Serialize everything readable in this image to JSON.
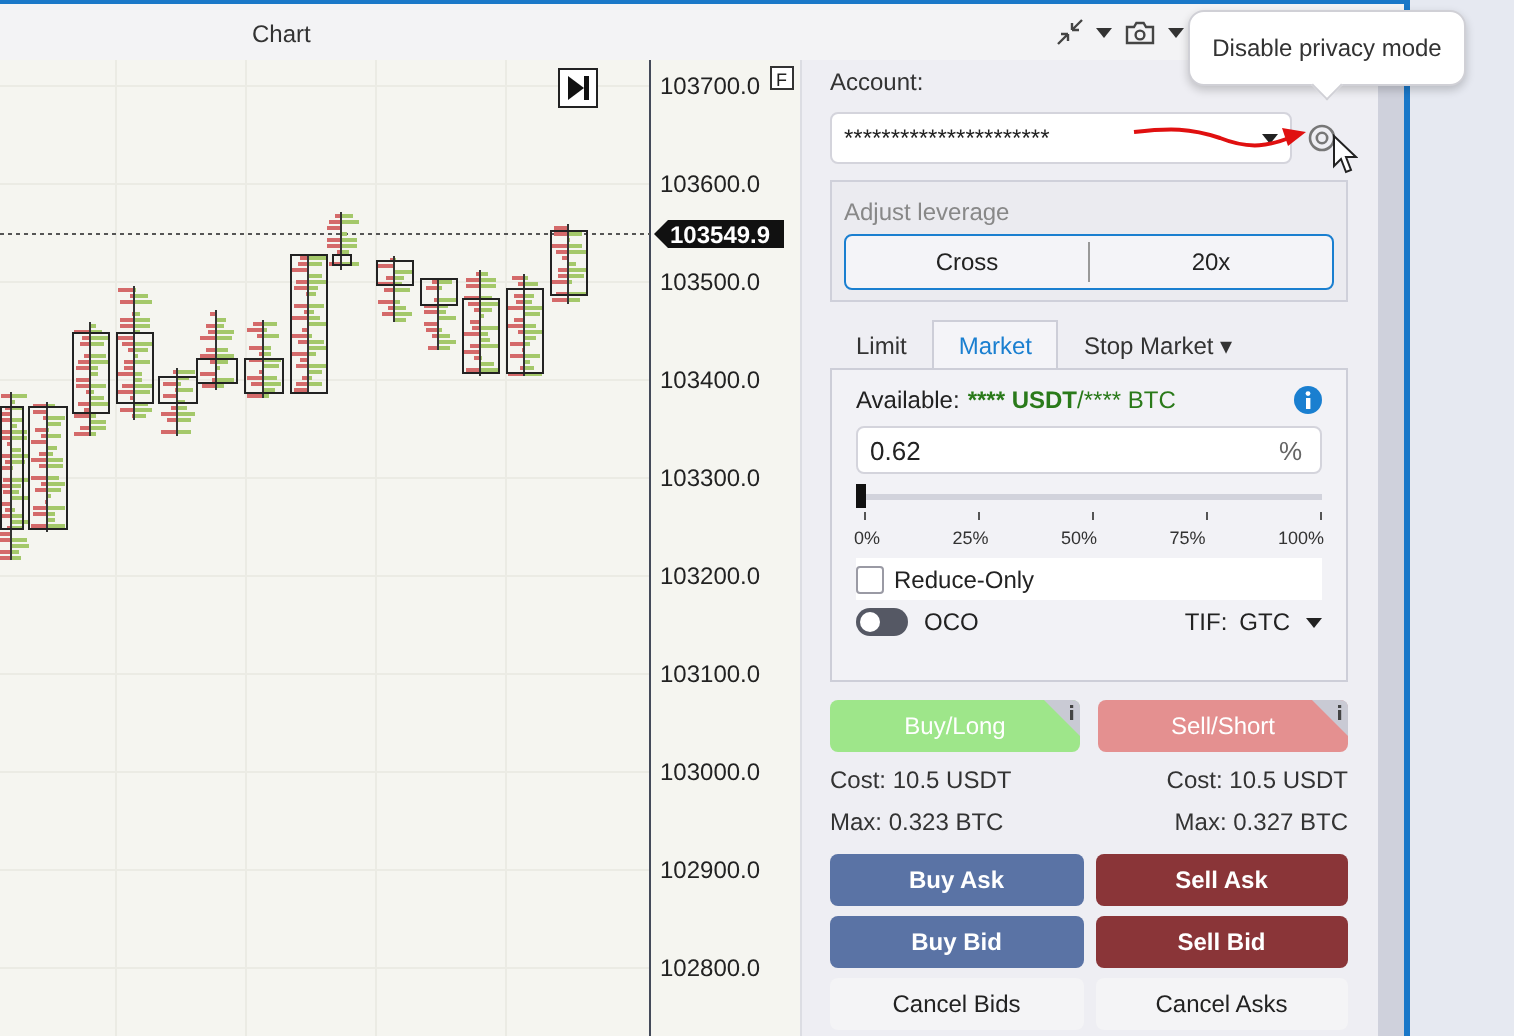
{
  "window": {
    "title": "Chart"
  },
  "chart": {
    "price_labels": [
      "103700.0",
      "103600.0",
      "103500.0",
      "103400.0",
      "103300.0",
      "103200.0",
      "103100.0",
      "103000.0",
      "102900.0",
      "102800.0"
    ],
    "current_price": "103549.9",
    "scale_button": "F"
  },
  "tooltip": {
    "text": "Disable privacy mode"
  },
  "order_panel": {
    "account": {
      "label": "Account:",
      "value": "**********************"
    },
    "leverage": {
      "label": "Adjust leverage",
      "margin_mode": "Cross",
      "value": "20x"
    },
    "tabs": [
      {
        "label": "Limit",
        "selected": false
      },
      {
        "label": "Market",
        "selected": true
      },
      {
        "label": "Stop Market ▾",
        "selected": false
      }
    ],
    "available": {
      "label": "Available:",
      "quote": "**** USDT",
      "base": "/**** BTC"
    },
    "amount": {
      "value": "0.62",
      "unit": "%"
    },
    "slider": {
      "level": 0,
      "ticks": [
        "0%",
        "25%",
        "50%",
        "75%",
        "100%"
      ]
    },
    "reduce_only": {
      "label": "Reduce-Only",
      "checked": false
    },
    "oco": {
      "label": "OCO",
      "on": false
    },
    "tif": {
      "label": "TIF:",
      "value": "GTC"
    },
    "sides": [
      {
        "kind": "buy",
        "label": "Buy/Long",
        "cost": "Cost: 10.5 USDT",
        "max": "Max: 0.323 BTC"
      },
      {
        "kind": "sell",
        "label": "Sell/Short",
        "cost": "Cost: 10.5 USDT",
        "max": "Max: 0.327 BTC"
      }
    ],
    "actions": [
      {
        "kind": "buy",
        "label": "Buy Ask"
      },
      {
        "kind": "sell",
        "label": "Sell Ask"
      },
      {
        "kind": "buy",
        "label": "Buy Bid"
      },
      {
        "kind": "sell",
        "label": "Sell Bid"
      },
      {
        "kind": "cancel",
        "label": "Cancel Bids"
      },
      {
        "kind": "cancel",
        "label": "Cancel Asks"
      }
    ]
  }
}
